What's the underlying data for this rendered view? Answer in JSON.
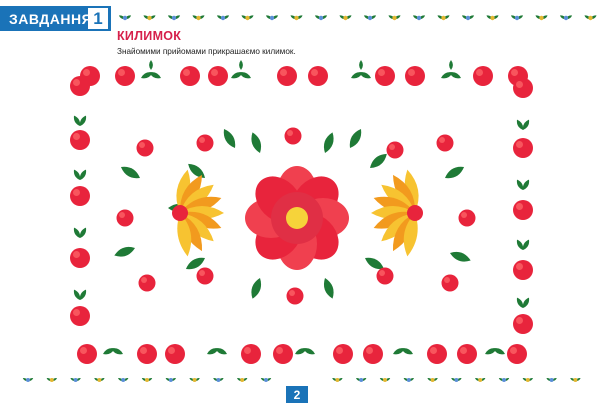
{
  "header": {
    "task_label": "ЗАВДАННЯ",
    "task_number": "1"
  },
  "title": "КИЛИМОК",
  "instruction": "Знайомими прийомами прикрашаємо килимок.",
  "footer": {
    "page_number": "2"
  },
  "colors": {
    "brand_blue": "#1a73b8",
    "title_red": "#d6204b",
    "berry_red": "#e8243c",
    "leaf_green": "#1f7a36",
    "petal_orange": "#f29a1e",
    "ornament_blue": "#5b8fd8",
    "ornament_yellow": "#e3b732"
  },
  "icons": [
    "berry-icon",
    "leaf-icon",
    "flower-icon",
    "floral-ornament-icon"
  ]
}
